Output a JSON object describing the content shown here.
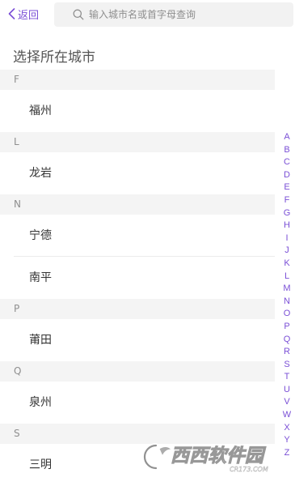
{
  "header": {
    "back_label": "返回",
    "search_placeholder": "输入城市名或首字母查询"
  },
  "page_title": "选择所在城市",
  "sections": [
    {
      "letter": "F",
      "cities": [
        "福州"
      ]
    },
    {
      "letter": "L",
      "cities": [
        "龙岩"
      ]
    },
    {
      "letter": "N",
      "cities": [
        "宁德",
        "南平"
      ]
    },
    {
      "letter": "P",
      "cities": [
        "莆田"
      ]
    },
    {
      "letter": "Q",
      "cities": [
        "泉州"
      ]
    },
    {
      "letter": "S",
      "cities": [
        "三明"
      ]
    }
  ],
  "alphabet_index": [
    "A",
    "B",
    "C",
    "D",
    "E",
    "F",
    "G",
    "H",
    "I",
    "J",
    "K",
    "L",
    "M",
    "N",
    "O",
    "P",
    "Q",
    "R",
    "S",
    "T",
    "U",
    "V",
    "W",
    "X",
    "Y",
    "Z"
  ],
  "watermark": {
    "text": "西西软件园",
    "subtext": "CR173.COM"
  },
  "colors": {
    "accent": "#7a4fd6",
    "section_bg": "#f4f4f4",
    "search_bg": "#f2f2f2"
  },
  "icons": {
    "back": "chevron-left-icon",
    "search": "search-icon"
  }
}
